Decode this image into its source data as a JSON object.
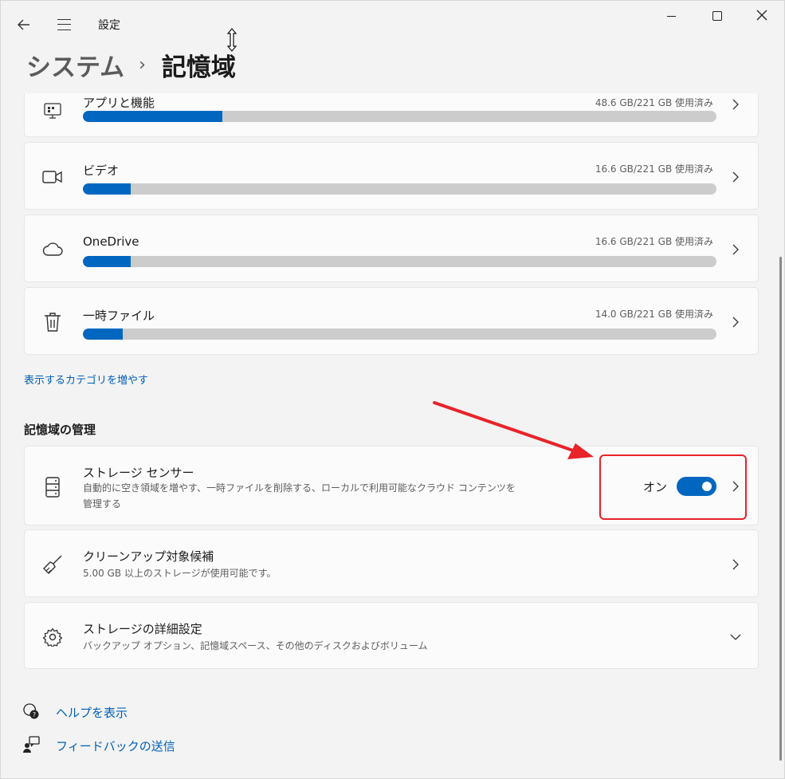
{
  "window": {
    "app_title": "設定",
    "back_icon": "arrow-left-icon",
    "menu_icon": "hamburger-icon"
  },
  "breadcrumb": {
    "parent": "システム",
    "separator": "›",
    "current": "記憶域"
  },
  "categories": [
    {
      "label": "アプリと機能",
      "usage": "48.6 GB/221 GB 使用済み",
      "fraction": 0.22,
      "icon": "apps-icon"
    },
    {
      "label": "ビデオ",
      "usage": "16.6 GB/221 GB 使用済み",
      "fraction": 0.075,
      "icon": "video-icon"
    },
    {
      "label": "OneDrive",
      "usage": "16.6 GB/221 GB 使用済み",
      "fraction": 0.075,
      "icon": "cloud-icon"
    },
    {
      "label": "一時ファイル",
      "usage": "14.0 GB/221 GB 使用済み",
      "fraction": 0.063,
      "icon": "trash-icon"
    }
  ],
  "show_more_link": "表示するカテゴリを増やす",
  "management": {
    "title": "記憶域の管理",
    "storage_sense": {
      "label": "ストレージ センサー",
      "description_line1": "自動的に空き領域を増やす、一時ファイルを削除する、ローカルで利用可能なクラウド コンテンツを",
      "description_line2": "管理する",
      "toggle_label": "オン",
      "toggle_on": true,
      "icon": "storage-drive-icon"
    },
    "cleanup": {
      "label": "クリーンアップ対象候補",
      "description": "5.00 GB 以上のストレージが使用可能です。",
      "icon": "broom-icon"
    },
    "advanced": {
      "label": "ストレージの詳細設定",
      "description": "バックアップ オプション、記憶域スペース、その他のディスクおよびボリューム",
      "icon": "gear-icon"
    }
  },
  "footer": {
    "help": "ヘルプを表示",
    "feedback": "フィードバックの送信"
  },
  "colors": {
    "accent": "#0067c0",
    "annotation": "#e8232a",
    "background": "#f3f3f3",
    "card": "#fbfbfb"
  }
}
